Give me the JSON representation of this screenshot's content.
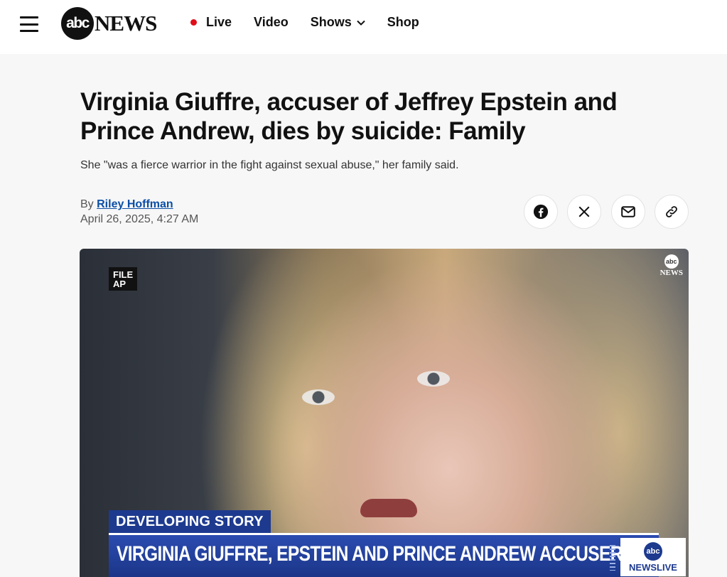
{
  "header": {
    "logo_mark": "abc",
    "logo_text": "NEWS",
    "nav": [
      {
        "label": "Live",
        "icon": "live-dot-icon"
      },
      {
        "label": "Video"
      },
      {
        "label": "Shows",
        "icon": "chevron-down-icon"
      },
      {
        "label": "Shop"
      }
    ],
    "live_color": "#e00d1a"
  },
  "article": {
    "headline": "Virginia Giuffre, accuser of Jeffrey Epstein and Prince Andrew, dies by suicide: Family",
    "subhead": "She \"was a fierce warrior in the fight against sexual abuse,\" her family said.",
    "by_prefix": "By",
    "author": "Riley Hoffman",
    "date": "April 26, 2025, 4:27 AM"
  },
  "share": [
    {
      "icon": "facebook-icon"
    },
    {
      "icon": "x-icon"
    },
    {
      "icon": "mail-icon"
    },
    {
      "icon": "link-icon"
    }
  ],
  "video": {
    "file_label_1": "FILE",
    "file_label_2": "AP",
    "corner_logo_mark": "abc",
    "corner_logo_text": "NEWS",
    "developing": "DEVELOPING STORY",
    "lower_third": "VIRGINIA GIUFFRE, EPSTEIN AND PRINCE ANDREW ACCUSER, DIES",
    "newslive_mark": "abc",
    "newslive_text": "NEWSLIVE",
    "accent": "#1d3a8f"
  }
}
